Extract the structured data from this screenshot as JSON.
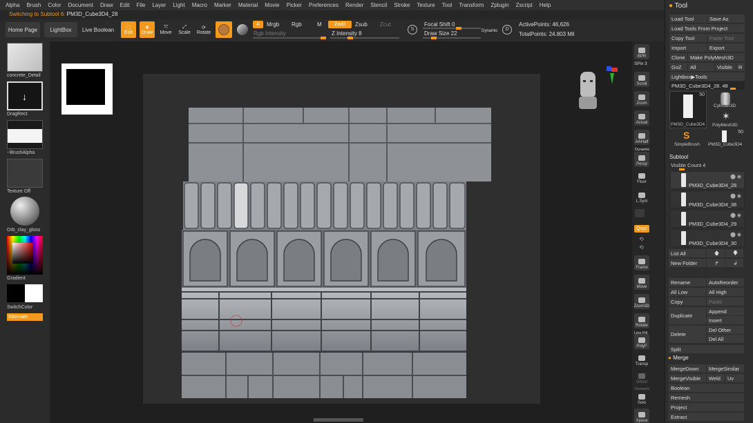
{
  "menu": [
    "Alpha",
    "Brush",
    "Color",
    "Document",
    "Draw",
    "Edit",
    "File",
    "Layer",
    "Light",
    "Macro",
    "Marker",
    "Material",
    "Movie",
    "Picker",
    "Preferences",
    "Render",
    "Stencil",
    "Stroke",
    "Texture",
    "Tool",
    "Transform",
    "Zplugin",
    "Zscript",
    "Help"
  ],
  "status": {
    "prefix": "Switching to Subtool 6:",
    "name": "PM3D_Cube3D4_28"
  },
  "shelf": {
    "home": "Home Page",
    "lightbox": "LightBox",
    "live_boolean": "Live Boolean",
    "edit": "Edit",
    "draw": "Draw",
    "move": "Move",
    "scale": "Scale",
    "rotate": "Rotate",
    "a": "A",
    "mrgb": "Mrgb",
    "rgb": "Rgb",
    "m": "M",
    "zadd": "Zadd",
    "zsub": "Zsub",
    "zcut": "Zcut",
    "rgb_intensity": "Rgb Intensity",
    "z_intensity": "Z Intensity 8",
    "focal_shift": "Focal Shift 0",
    "draw_size": "Draw Size 22",
    "dynamic": "Dynamic",
    "active_points": "ActivePoints: 46,626",
    "total_points": "TotalPoints: 24.803 Mil"
  },
  "left": {
    "material": "concrete_Detail",
    "stroke": "DragRect",
    "alpha": "~BrushAlpha",
    "texture": "Texture Off",
    "matcap": "Orb_clay_gloss",
    "gradient": "Gradient",
    "switch": "SwitchColor",
    "alternate": "Alternate"
  },
  "right_toolbar": [
    "BPR",
    "SPix 3",
    "Scroll",
    "Zoom",
    "Actual",
    "AAHalf",
    "Dynamic",
    "Persp",
    "Floor",
    "L.Sym",
    "Qxyz",
    "Frame",
    "Move",
    "Zoom3D",
    "Rotate",
    "Line Fill",
    "PolyF",
    "Transp",
    "Ghost",
    "Dynamic",
    "Solo",
    "Xpose"
  ],
  "tool": {
    "title": "Tool",
    "load_tool": "Load Tool",
    "save_as": "Save As",
    "load_project": "Load Tools From Project",
    "copy_tool": "Copy Tool",
    "paste_tool": "Paste Tool",
    "import": "Import",
    "export": "Export",
    "clone": "Clone",
    "make_polymesh": "Make PolyMesh3D",
    "goz": "GoZ",
    "all": "All",
    "visible": "Visible",
    "r": "R",
    "lightbox_tools": "Lightbox▶Tools",
    "current": "PM3D_Cube3D4_28. 48",
    "thumbs": [
      {
        "name": "PM3D_Cube3D4",
        "count": "50"
      },
      {
        "name": "Cylinder3D"
      },
      {
        "name": "PolyMesh3D"
      },
      {
        "name": "SimpleBrush"
      },
      {
        "name": "PM3D_Cube3D4",
        "count": "50"
      }
    ],
    "subtool": "Subtool",
    "visible_count": "Visible Count 4",
    "subtools": [
      "PM3D_Cube3D4_28",
      "PM3D_Cube3D4_38",
      "PM3D_Cube3D4_29",
      "PM3D_Cube3D4_30"
    ],
    "list_all": "List All",
    "new_folder": "New Folder",
    "rename": "Rename",
    "autoreorder": "AutoReorder",
    "all_low": "All Low",
    "all_high": "All High",
    "copy": "Copy",
    "paste": "Paste",
    "duplicate": "Duplicate",
    "append": "Append",
    "insert": "Insert",
    "delete": "Delete",
    "del_other": "Del Other",
    "del_all": "Del All",
    "split": "Split",
    "merge": "Merge",
    "mergedown": "MergeDown",
    "mergesimilar": "MergeSimilar",
    "mergevisible": "MergeVisible",
    "weld": "Weld",
    "uv": "Uv",
    "boolean": "Boolean",
    "remesh": "Remesh",
    "project": "Project",
    "extract": "Extract"
  },
  "colors": {
    "accent": "#f39a1e",
    "bg": "#262626",
    "panel": "#2e2e2e"
  }
}
